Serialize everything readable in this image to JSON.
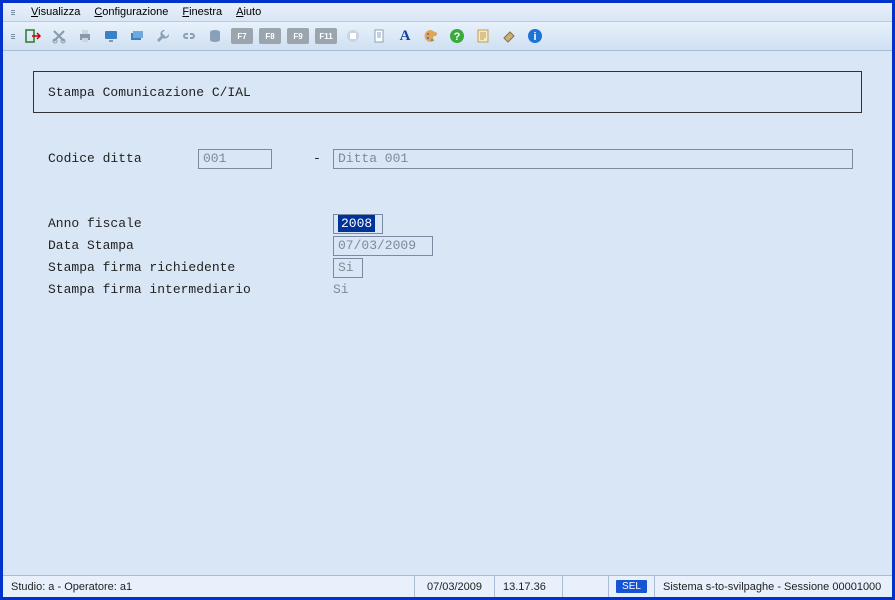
{
  "menu": {
    "visualizza": "Visualizza",
    "configurazione": "Configurazione",
    "finestra": "Finestra",
    "aiuto": "Aiuto"
  },
  "toolbar": {
    "fkeys": {
      "f7": "F7",
      "f8": "F8",
      "f9": "F9",
      "f11": "F11"
    },
    "letter_a": "A"
  },
  "panel": {
    "title": "Stampa Comunicazione C/IAL"
  },
  "form": {
    "codice_ditta_label": "Codice ditta",
    "codice_ditta_value": "001",
    "dash": "-",
    "ditta_desc_value": "Ditta 001",
    "anno_fiscale_label": "Anno fiscale",
    "anno_fiscale_value": "2008",
    "data_stampa_label": "Data Stampa",
    "data_stampa_value": "07/03/2009",
    "stampa_firma_rich_label": "Stampa firma richiedente",
    "stampa_firma_rich_value": "Si",
    "stampa_firma_inter_label": "Stampa firma intermediario",
    "stampa_firma_inter_value": "Si"
  },
  "status": {
    "left": "Studio: a - Operatore: a1",
    "date": "07/03/2009",
    "time": "13.17.36",
    "sel": "SEL",
    "right": "Sistema s-to-svilpaghe - Sessione 00001000"
  }
}
